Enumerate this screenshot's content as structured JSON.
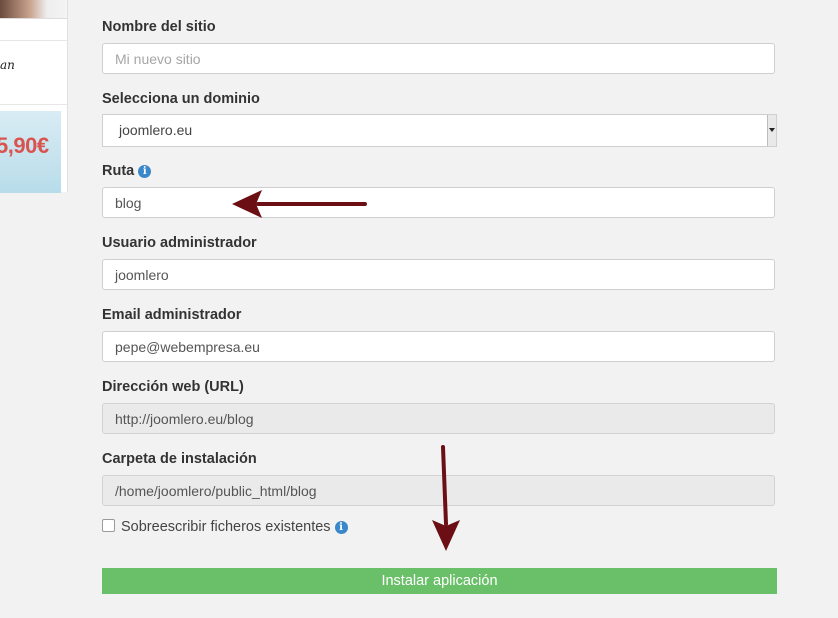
{
  "sidebar": {
    "logo_text": "an",
    "banner_price": "5,90€"
  },
  "form": {
    "site_name": {
      "label": "Nombre del sitio",
      "placeholder": "Mi nuevo sitio",
      "value": ""
    },
    "domain": {
      "label": "Selecciona un dominio",
      "value": "joomlero.eu"
    },
    "path": {
      "label": "Ruta",
      "value": "blog",
      "icon": "info-icon"
    },
    "admin_user": {
      "label": "Usuario administrador",
      "value": "joomlero"
    },
    "admin_email": {
      "label": "Email administrador",
      "value": "pepe@webempresa.eu"
    },
    "url": {
      "label": "Dirección web (URL)",
      "value": "http://joomlero.eu/blog"
    },
    "install_folder": {
      "label": "Carpeta de instalación",
      "value": "/home/joomlero/public_html/blog"
    },
    "overwrite": {
      "label": "Sobreescribir ficheros existentes",
      "checked": false,
      "icon": "info-icon"
    },
    "install_button": {
      "label": "Instalar aplicación"
    }
  },
  "colors": {
    "button": "#6abf69",
    "info_icon": "#3a87c9",
    "arrow": "#6b0f14",
    "price": "#d9534f"
  }
}
